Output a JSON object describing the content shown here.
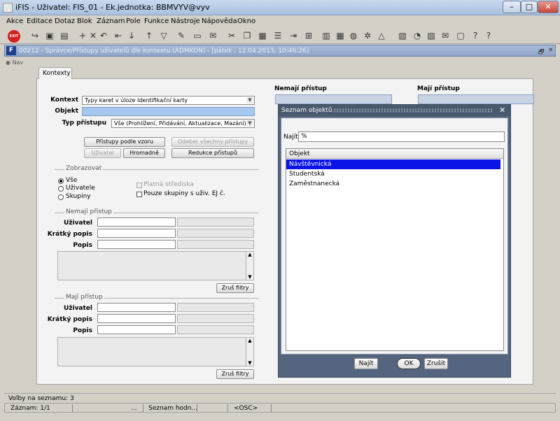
{
  "window": {
    "title": "iFIS - Uživatel: FIS_01 - Ek.jednotka: BBMVYV@vyv",
    "app_icon": "iFIS",
    "min": "–",
    "max": "□",
    "close": "✕"
  },
  "menu": [
    "Akce",
    "Editace",
    "Dotaz",
    "Blok",
    "Záznam",
    "Pole",
    "Funkce",
    "Nástroje",
    "Nápověda",
    "Okno"
  ],
  "toolbar": {
    "exit_label": "EXIT"
  },
  "inner_window": {
    "title": "00212 - Správce/Přístupy uživatelů dle kontextu (ADMKON) - [pátek , 12.04.2013, 10:46:26]",
    "icon": "F",
    "restore": "🗗",
    "close": "✕"
  },
  "nav": {
    "label": "Nav"
  },
  "tab": {
    "label": "Kontexty"
  },
  "form": {
    "kontext_label": "Kontext",
    "kontext_value": "Typy karet v úloze Identifikační karty",
    "objekt_label": "Objekt",
    "objekt_value": "",
    "typ_label": "Typ přístupu",
    "typ_value": "Vše (Prohlížení, Přidávání, Aktualizace, Mazání)",
    "btn_pristupy": "Přístupy podle vzoru",
    "btn_odeber": "Odeber všechny přístupy",
    "btn_uzivatel": "Uživatel",
    "btn_hromadne": "Hromadně",
    "btn_redukce": "Redukce přístupů",
    "zobrazovat_title": "Zobrazovat",
    "radio_vse": "Vše",
    "radio_uzivatele": "Uživatele",
    "radio_skupiny": "Skupiny",
    "chk_platna": "Platná střediska",
    "chk_pouze": "Pouze skupiny s uživ. EJ č.",
    "nemaji_title": "Nemají přístup",
    "maji_title": "Mají přístup",
    "uzivatel_label": "Uživatel",
    "kratky_label": "Krátký popis",
    "popis_label": "Popis",
    "zrus_filtry": "Zruš filtry"
  },
  "columns": {
    "nemaji_head": "Nemají přístup",
    "maji_head": "Mají přístup"
  },
  "dialog": {
    "title": "Seznam objektů",
    "close": "✕",
    "najit_label": "Najít",
    "najit_value": "%",
    "list_header": "Objekt",
    "items": [
      "Návštěvnická",
      "Studentská",
      "Zaměstnanecká"
    ],
    "selected_index": 0,
    "btn_najit": "Najít",
    "btn_ok": "OK",
    "btn_zrusit": "Zrušit"
  },
  "status": {
    "line1": "Volby na seznamu: 3",
    "zaznam": "Záznam: 1/1",
    "dots": "...",
    "seznam": "Seznam hodn...",
    "osc": "<OSC>"
  }
}
